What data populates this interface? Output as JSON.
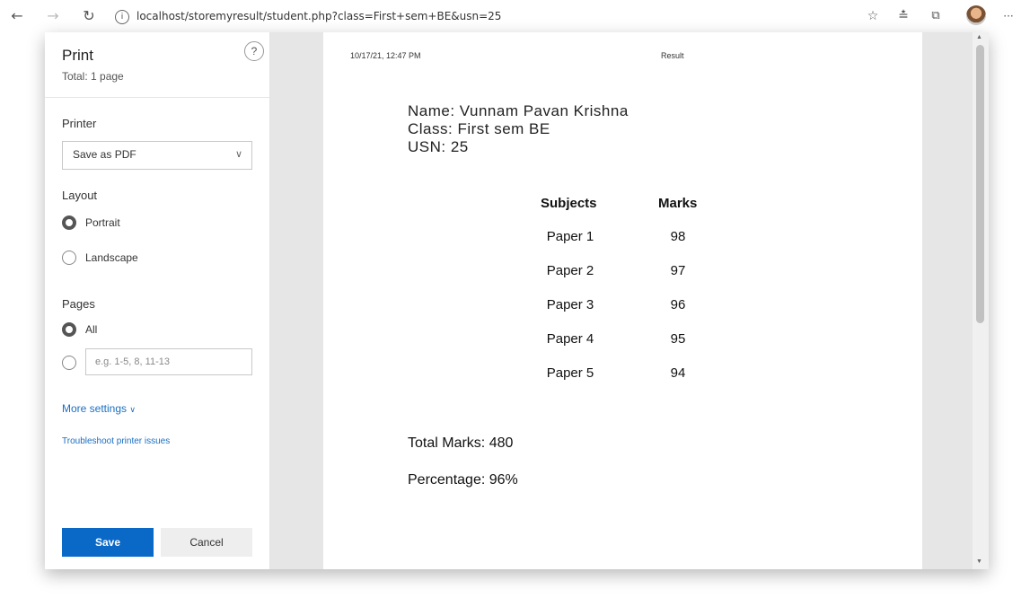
{
  "browser": {
    "url": "localhost/storemyresult/student.php?class=First+sem+BE&usn=25",
    "icons": [
      "back-arrow-icon",
      "forward-arrow-icon",
      "refresh-icon",
      "info-icon",
      "add-favorite-icon",
      "favorites-icon",
      "collections-icon",
      "profile-avatar",
      "more-icon"
    ]
  },
  "print_panel": {
    "title": "Print",
    "total": "Total: 1 page",
    "help": "?",
    "printer_label": "Printer",
    "printer_value": "Save as PDF",
    "layout_label": "Layout",
    "portrait": "Portrait",
    "landscape": "Landscape",
    "pages_label": "Pages",
    "all": "All",
    "range_placeholder": "e.g. 1-5, 8, 11-13",
    "more_settings": "More settings",
    "troubleshoot": "Troubleshoot printer issues",
    "save": "Save",
    "cancel": "Cancel"
  },
  "page": {
    "timestamp": "10/17/21, 12:47 PM",
    "doc_title": "Result",
    "name": "Name: Vunnam Pavan Krishna",
    "class": "Class: First sem BE",
    "usn": "USN: 25",
    "table": {
      "headers": [
        "Subjects",
        "Marks"
      ],
      "rows": [
        [
          "Paper 1",
          "98"
        ],
        [
          "Paper 2",
          "97"
        ],
        [
          "Paper 3",
          "96"
        ],
        [
          "Paper 4",
          "95"
        ],
        [
          "Paper 5",
          "94"
        ]
      ]
    },
    "total": "Total Marks: 480",
    "percentage": "Percentage: 96%"
  }
}
